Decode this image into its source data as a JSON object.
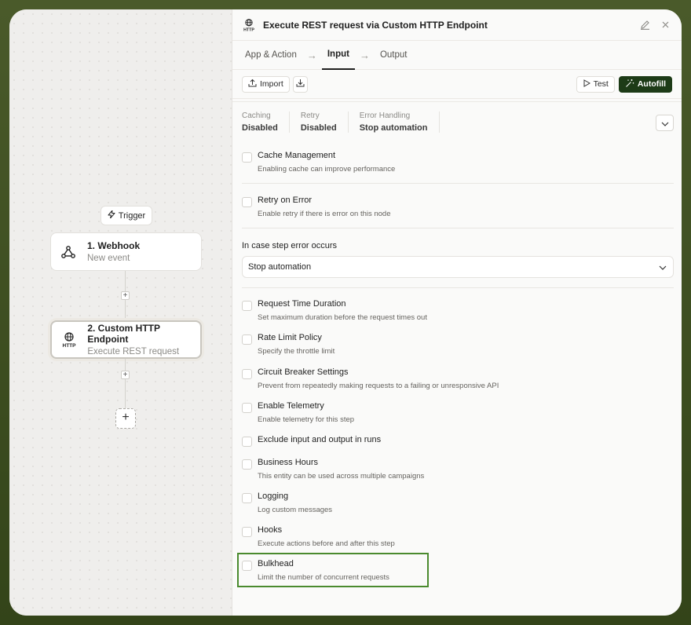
{
  "canvas": {
    "trigger_label": "Trigger",
    "nodes": [
      {
        "title": "1. Webhook",
        "subtitle": "New event"
      },
      {
        "title": "2. Custom HTTP Endpoint",
        "subtitle": "Execute REST request"
      }
    ],
    "http_icon_label": "HTTP"
  },
  "panel": {
    "title": "Execute REST request via Custom HTTP Endpoint",
    "tabs": [
      {
        "label": "App & Action"
      },
      {
        "label": "Input"
      },
      {
        "label": "Output"
      }
    ],
    "toolbar": {
      "import_label": "Import",
      "test_label": "Test",
      "autofill_label": "Autofill"
    },
    "summary": [
      {
        "label": "Caching",
        "value": "Disabled"
      },
      {
        "label": "Retry",
        "value": "Disabled"
      },
      {
        "label": "Error Handling",
        "value": "Stop automation"
      }
    ],
    "options_top": [
      {
        "title": "Cache Management",
        "desc": "Enabling cache can improve performance"
      },
      {
        "title": "Retry on Error",
        "desc": "Enable retry if there is error on this node"
      }
    ],
    "error_select": {
      "label": "In case step error occurs",
      "value": "Stop automation"
    },
    "options": [
      {
        "title": "Request Time Duration",
        "desc": "Set maximum duration before the request times out"
      },
      {
        "title": "Rate Limit Policy",
        "desc": "Specify the throttle limit"
      },
      {
        "title": "Circuit Breaker Settings",
        "desc": "Prevent from repeatedly making requests to a failing or unresponsive API"
      },
      {
        "title": "Enable Telemetry",
        "desc": "Enable telemetry for this step"
      },
      {
        "title": "Exclude input and output in runs",
        "desc": ""
      },
      {
        "title": "Business Hours",
        "desc": "This entity can be used across multiple campaigns"
      },
      {
        "title": "Logging",
        "desc": "Log custom messages"
      },
      {
        "title": "Hooks",
        "desc": "Execute actions before and after this step"
      },
      {
        "title": "Bulkhead",
        "desc": "Limit the number of concurrent requests"
      }
    ]
  },
  "colors": {
    "accent": "#1d3b17",
    "highlight": "#4a8a2e"
  }
}
